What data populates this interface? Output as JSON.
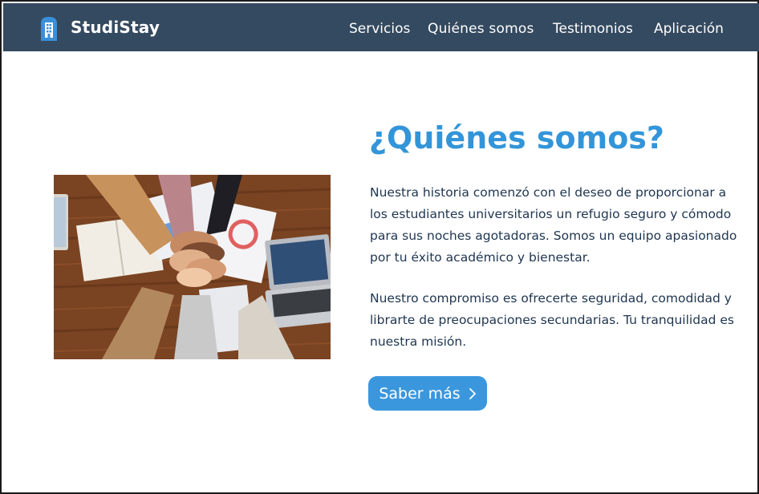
{
  "brand": {
    "name": "StudiStay",
    "logo_icon": "building-icon"
  },
  "nav": {
    "items": [
      {
        "label": "Servicios"
      },
      {
        "label": "Quiénes somos"
      },
      {
        "label": "Testimonios"
      },
      {
        "label": "Aplicación"
      }
    ]
  },
  "about": {
    "title": "¿Quiénes somos?",
    "paragraph1": "Nuestra historia comenzó con el deseo de proporcionar a los estudiantes universitarios un refugio seguro y cómodo para sus noches agotadoras. Somos un equipo apasionado por tu éxito académico y bienestar.",
    "paragraph2": "Nuestro compromiso es ofrecerte seguridad, comodidad y librarte de preocupaciones secundarias. Tu tranquilidad es nuestra misión.",
    "cta_label": "Saber más",
    "cta_icon": "chevron-right-icon",
    "image": "team-hands-stacked-photo"
  },
  "colors": {
    "navbar": "#344a60",
    "accent": "#3395d9",
    "body_text": "#1e3550",
    "button": "#3b97dd"
  }
}
